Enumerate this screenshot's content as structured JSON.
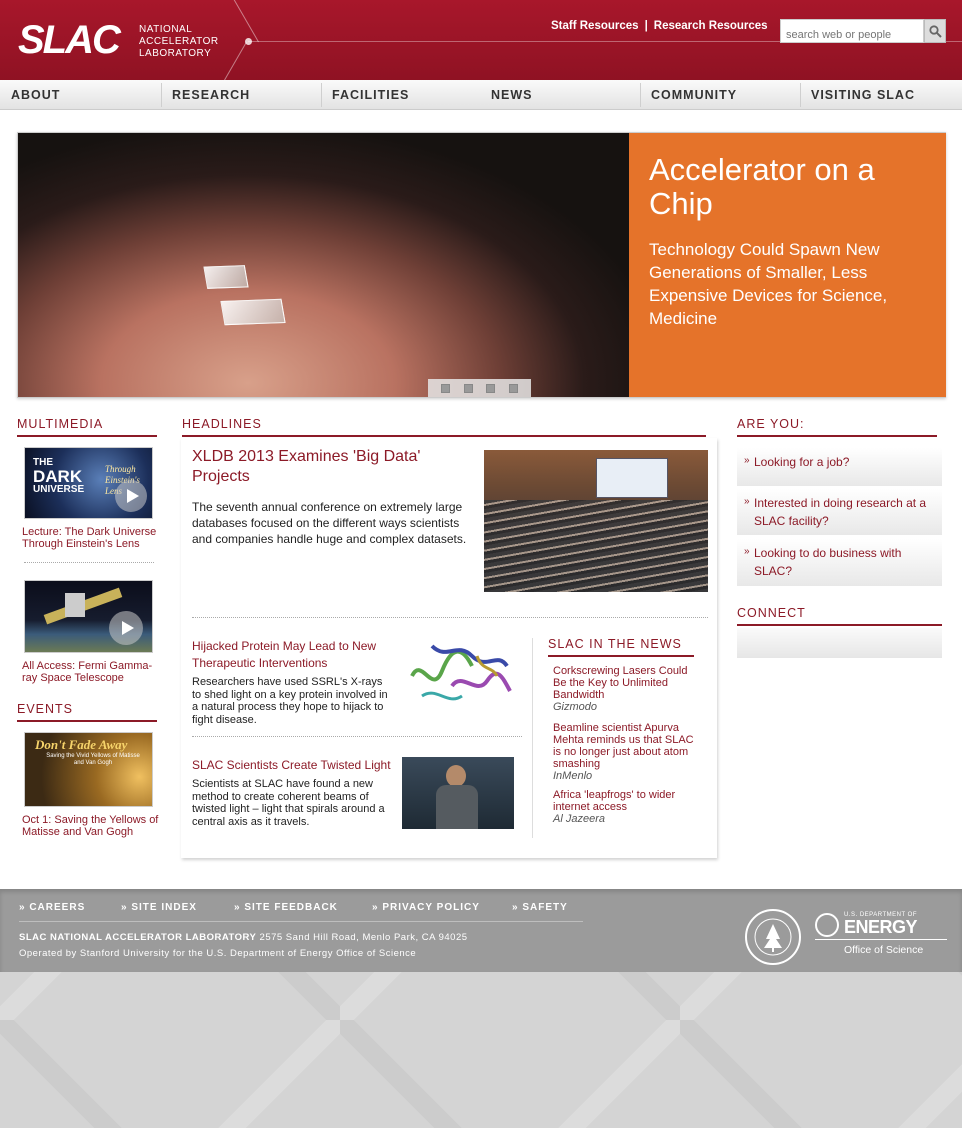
{
  "header": {
    "logo": "SLAC",
    "logo_lines": [
      "NATIONAL",
      "ACCELERATOR",
      "LABORATORY"
    ],
    "top_links": [
      "Staff Resources",
      "Research Resources"
    ],
    "search_placeholder": "search web or people"
  },
  "nav": [
    "ABOUT",
    "RESEARCH",
    "FACILITIES",
    "NEWS",
    "COMMUNITY",
    "VISITING SLAC"
  ],
  "hero": {
    "title": "Accelerator on a Chip",
    "subtitle": "Technology Could Spawn New Generations of Smaller, Less Expensive Devices for Science, Medicine",
    "pages": 4
  },
  "multimedia": {
    "heading": "MULTIMEDIA",
    "items": [
      {
        "caption": "Lecture: The Dark Universe Through Einstein's Lens",
        "thumb_text": [
          "THE",
          "DARK",
          "UNIVERSE",
          "Through",
          "Einstein's",
          "Lens"
        ]
      },
      {
        "caption": "All Access: Fermi Gamma-ray Space Telescope"
      }
    ]
  },
  "events": {
    "heading": "EVENTS",
    "items": [
      {
        "caption": "Oct 1: Saving the Yellows of Matisse and Van Gogh",
        "thumb_title": "Don't Fade Away",
        "thumb_sub": "Saving the Vivid Yellows of Matisse and Van Gogh"
      }
    ]
  },
  "headlines": {
    "heading": "HEADLINES",
    "lead": {
      "title": "XLDB 2013 Examines 'Big Data' Projects",
      "text": "The seventh annual conference on extremely large databases focused on the different ways scientists and companies handle huge and complex datasets."
    },
    "items": [
      {
        "title": "Hijacked Protein May Lead to New Therapeutic Interventions",
        "text": "Researchers have used SSRL's X-rays to shed light on a key protein involved in a natural process they hope to hijack to fight disease."
      },
      {
        "title": "SLAC Scientists Create Twisted Light",
        "text": "Scientists at SLAC have found a new method to create coherent beams of twisted light – light that spirals around a central axis as it travels."
      }
    ]
  },
  "in_the_news": {
    "heading": "SLAC IN THE NEWS",
    "items": [
      {
        "title": "Corkscrewing Lasers Could Be the Key to Unlimited Bandwidth",
        "source": "Gizmodo"
      },
      {
        "title": "Beamline scientist Apurva Mehta reminds us that SLAC is no longer just about atom smashing",
        "source": "InMenlo"
      },
      {
        "title": "Africa 'leapfrogs' to wider internet access",
        "source": "Al Jazeera"
      }
    ]
  },
  "are_you": {
    "heading": "ARE YOU:",
    "items": [
      "Looking for a job?",
      "Interested in doing research at a SLAC facility?",
      "Looking to do business with SLAC?"
    ]
  },
  "connect": {
    "heading": "CONNECT"
  },
  "footer": {
    "links": [
      "» CAREERS",
      "» SITE INDEX",
      "» SITE FEEDBACK",
      "» PRIVACY POLICY",
      "» SAFETY"
    ],
    "org": "SLAC NATIONAL ACCELERATOR LABORATORY",
    "address": "2575 Sand Hill Road, Menlo Park, CA 94025",
    "operated": "Operated by Stanford University for the U.S. Department of Energy Office of Science",
    "doe_small": "U.S. DEPARTMENT OF",
    "doe_big": "ENERGY",
    "doe_office": "Office of Science"
  },
  "colors": {
    "brand": "#a8172b",
    "accent": "#e5732a",
    "link": "#8c1a27"
  }
}
